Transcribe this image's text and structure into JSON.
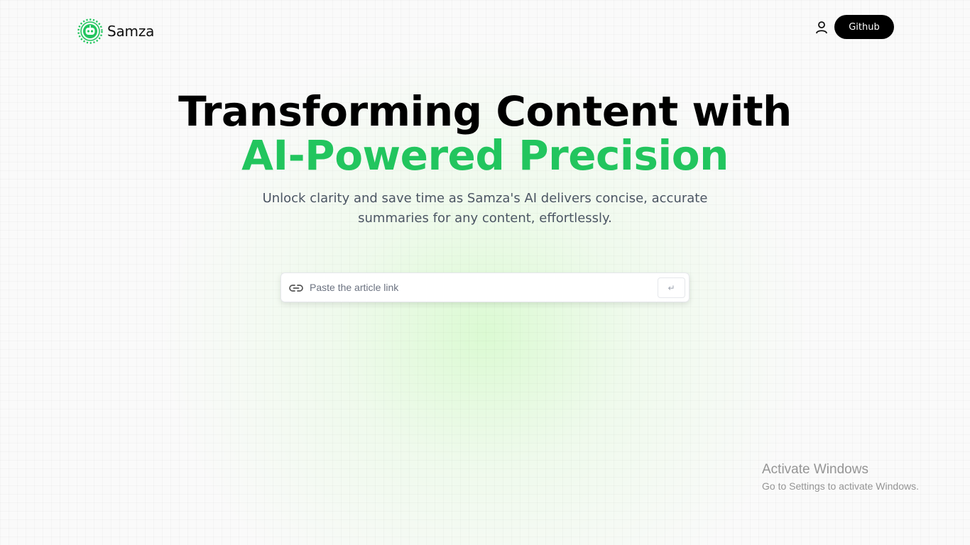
{
  "brand": {
    "name": "Samza",
    "logo_icon": "robot-gear-logo-icon",
    "accent_color": "#22c55e"
  },
  "nav": {
    "user_icon": "user-icon",
    "github_label": "Github"
  },
  "hero": {
    "title_line1": "Transforming Content with",
    "title_line2": "AI-Powered Precision",
    "subtitle": "Unlock clarity and save time as Samza's AI delivers concise, accurate summaries for any content, effortlessly."
  },
  "search": {
    "link_icon": "link-icon",
    "placeholder": "Paste the article link",
    "value": "",
    "submit_label": "↵"
  },
  "os_watermark": {
    "title": "Activate Windows",
    "subtitle": "Go to Settings to activate Windows."
  }
}
